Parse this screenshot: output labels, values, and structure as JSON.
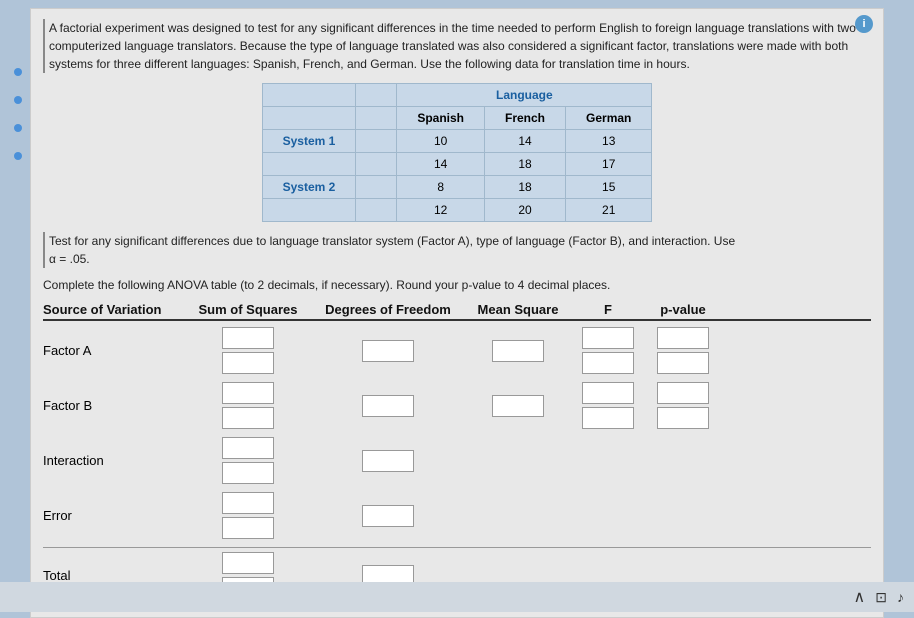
{
  "info_icon": "i",
  "paragraph": "A factorial experiment was designed to test for any significant differences in the time needed to perform English to foreign language translations with two computerized language translators. Because the type of language translated was also considered a significant factor, translations were made with both systems for three different languages: Spanish, French, and German. Use the following data for translation time in hours.",
  "table": {
    "language_header": "Language",
    "col_headers": [
      "Spanish",
      "French",
      "German"
    ],
    "rows": [
      {
        "label": "System 1",
        "values": [
          "10",
          "14",
          "13"
        ]
      },
      {
        "label": "",
        "values": [
          "14",
          "18",
          "17"
        ]
      },
      {
        "label": "System 2",
        "values": [
          "8",
          "18",
          "15"
        ]
      },
      {
        "label": "",
        "values": [
          "12",
          "20",
          "21"
        ]
      }
    ]
  },
  "instructions1": "Test for any significant differences due to language translator system (Factor A), type of language (Factor B), and interaction. Use",
  "alpha": "α = .05.",
  "instructions2": "Complete the following ANOVA table (to 2 decimals, if necessary). Round your p-value to 4 decimal places.",
  "anova": {
    "headers": {
      "source": "Source of Variation",
      "ss": "Sum of Squares",
      "df": "Degrees of Freedom",
      "ms": "Mean Square",
      "f": "F",
      "p": "p-value"
    },
    "rows": [
      {
        "label": "Factor A",
        "ss_count": 2,
        "df_count": 1,
        "ms_count": 1,
        "f_count": 2,
        "p_count": 2
      },
      {
        "label": "Factor B",
        "ss_count": 2,
        "df_count": 1,
        "ms_count": 1,
        "f_count": 2,
        "p_count": 2
      },
      {
        "label": "Interaction",
        "ss_count": 2,
        "df_count": 1,
        "ms_count": 0,
        "f_count": 0,
        "p_count": 0
      },
      {
        "label": "Error",
        "ss_count": 2,
        "df_count": 1,
        "ms_count": 0,
        "f_count": 0,
        "p_count": 0
      },
      {
        "label": "Total",
        "ss_count": 2,
        "df_count": 1,
        "ms_count": 0,
        "f_count": 0,
        "p_count": 0
      }
    ]
  },
  "bottom": {
    "chevron_up": "∧",
    "icon1": "⊡",
    "icon2": "♪"
  }
}
